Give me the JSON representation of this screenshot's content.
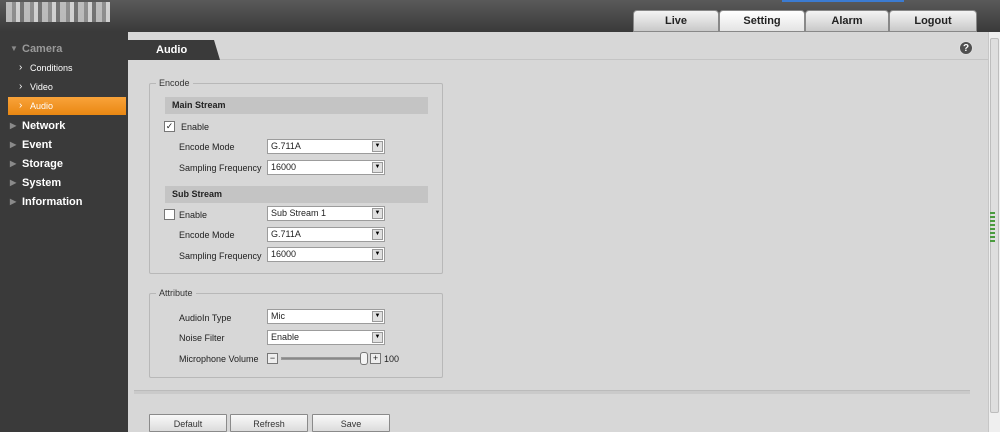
{
  "topnav": {
    "tabs": [
      {
        "label": "Live"
      },
      {
        "label": "Setting"
      },
      {
        "label": "Alarm"
      },
      {
        "label": "Logout"
      }
    ],
    "active": "Setting"
  },
  "sidebar": {
    "camera": {
      "label": "Camera",
      "children": [
        {
          "label": "Conditions"
        },
        {
          "label": "Video"
        },
        {
          "label": "Audio"
        }
      ]
    },
    "others": [
      {
        "label": "Network"
      },
      {
        "label": "Event"
      },
      {
        "label": "Storage"
      },
      {
        "label": "System"
      },
      {
        "label": "Information"
      }
    ]
  },
  "page": {
    "tab": "Audio",
    "help": "?"
  },
  "encode": {
    "legend": "Encode",
    "main_stream": {
      "title": "Main Stream",
      "enable_label": "Enable",
      "enabled": true,
      "encode_mode_label": "Encode Mode",
      "encode_mode": "G.711A",
      "sampling_label": "Sampling Frequency",
      "sampling": "16000"
    },
    "sub_stream": {
      "title": "Sub Stream",
      "enable_label": "Enable",
      "enabled": false,
      "stream_select": "Sub Stream 1",
      "encode_mode_label": "Encode Mode",
      "encode_mode": "G.711A",
      "sampling_label": "Sampling Frequency",
      "sampling": "16000"
    }
  },
  "attribute": {
    "legend": "Attribute",
    "audioin_label": "AudioIn Type",
    "audioin": "Mic",
    "noise_label": "Noise Filter",
    "noise": "Enable",
    "volume_label": "Microphone Volume",
    "volume": "100",
    "volume_fraction": 1.0
  },
  "buttons": {
    "default": "Default",
    "refresh": "Refresh",
    "save": "Save"
  },
  "colors": {
    "accent": "#f39b2a",
    "sidebar": "#3a3a3a",
    "background": "#d7d7d7"
  }
}
